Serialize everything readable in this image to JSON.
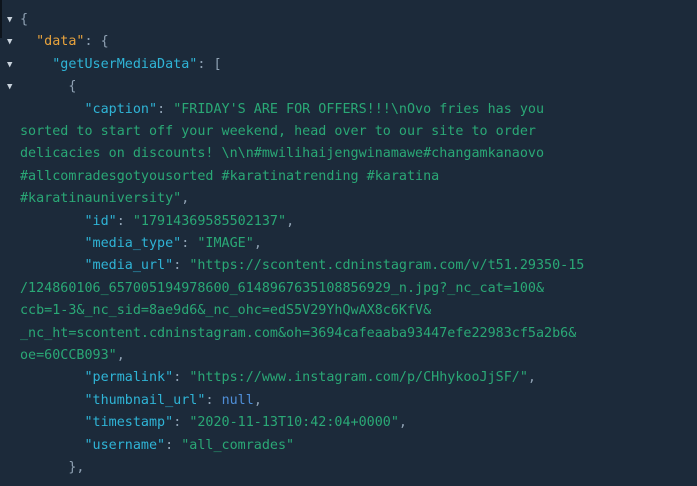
{
  "json_viewer": {
    "arrow_glyph": "▼",
    "lines": [
      {
        "has_arrow": true,
        "indent": "",
        "parts": [
          {
            "t": "{",
            "c": "p"
          }
        ]
      },
      {
        "has_arrow": true,
        "indent": "  ",
        "parts": [
          {
            "t": "\"data\"",
            "c": "k-orange"
          },
          {
            "t": ": {",
            "c": "p"
          }
        ]
      },
      {
        "has_arrow": true,
        "indent": "    ",
        "parts": [
          {
            "t": "\"getUserMediaData\"",
            "c": "k-teal"
          },
          {
            "t": ": [",
            "c": "p"
          }
        ]
      },
      {
        "has_arrow": true,
        "indent": "      ",
        "parts": [
          {
            "t": "{",
            "c": "p"
          }
        ]
      },
      {
        "has_arrow": false,
        "indent": "        ",
        "parts": [
          {
            "t": "\"caption\"",
            "c": "k-teal"
          },
          {
            "t": ": ",
            "c": "p"
          },
          {
            "t": "\"FRIDAY'S ARE FOR OFFERS!!!\\nOvo fries has you",
            "c": "s"
          }
        ]
      },
      {
        "has_arrow": false,
        "indent": "",
        "parts": [
          {
            "t": "sorted to start off your weekend, head over to our site to order",
            "c": "s"
          }
        ]
      },
      {
        "has_arrow": false,
        "indent": "",
        "parts": [
          {
            "t": "delicacies on discounts! \\n\\n#mwilihaijengwinamawe#changamkanaovo",
            "c": "s"
          }
        ]
      },
      {
        "has_arrow": false,
        "indent": "",
        "parts": [
          {
            "t": "#allcomradesgotyousorted #karatinatrending #karatina",
            "c": "s"
          }
        ]
      },
      {
        "has_arrow": false,
        "indent": "",
        "parts": [
          {
            "t": "#karatinauniversity\"",
            "c": "s"
          },
          {
            "t": ",",
            "c": "p"
          }
        ]
      },
      {
        "has_arrow": false,
        "indent": "        ",
        "parts": [
          {
            "t": "\"id\"",
            "c": "k-teal"
          },
          {
            "t": ": ",
            "c": "p"
          },
          {
            "t": "\"17914369585502137\"",
            "c": "s"
          },
          {
            "t": ",",
            "c": "p"
          }
        ]
      },
      {
        "has_arrow": false,
        "indent": "        ",
        "parts": [
          {
            "t": "\"media_type\"",
            "c": "k-teal"
          },
          {
            "t": ": ",
            "c": "p"
          },
          {
            "t": "\"IMAGE\"",
            "c": "s"
          },
          {
            "t": ",",
            "c": "p"
          }
        ]
      },
      {
        "has_arrow": false,
        "indent": "        ",
        "parts": [
          {
            "t": "\"media_url\"",
            "c": "k-teal"
          },
          {
            "t": ": ",
            "c": "p"
          },
          {
            "t": "\"https://scontent.cdninstagram.com/v/t51.29350-15",
            "c": "s"
          }
        ]
      },
      {
        "has_arrow": false,
        "indent": "",
        "parts": [
          {
            "t": "/124860106_657005194978600_6148967635108856929_n.jpg?_nc_cat=100&",
            "c": "s"
          }
        ]
      },
      {
        "has_arrow": false,
        "indent": "",
        "parts": [
          {
            "t": "ccb=1-3&_nc_sid=8ae9d6&_nc_ohc=edS5V29YhQwAX8c6KfV&",
            "c": "s"
          }
        ]
      },
      {
        "has_arrow": false,
        "indent": "",
        "parts": [
          {
            "t": "_nc_ht=scontent.cdninstagram.com&oh=3694cafeaaba93447efe22983cf5a2b6&",
            "c": "s"
          }
        ]
      },
      {
        "has_arrow": false,
        "indent": "",
        "parts": [
          {
            "t": "oe=60CCB093\"",
            "c": "s"
          },
          {
            "t": ",",
            "c": "p"
          }
        ]
      },
      {
        "has_arrow": false,
        "indent": "        ",
        "parts": [
          {
            "t": "\"permalink\"",
            "c": "k-teal"
          },
          {
            "t": ": ",
            "c": "p"
          },
          {
            "t": "\"https://www.instagram.com/p/CHhykooJjSF/\"",
            "c": "s"
          },
          {
            "t": ",",
            "c": "p"
          }
        ]
      },
      {
        "has_arrow": false,
        "indent": "        ",
        "parts": [
          {
            "t": "\"thumbnail_url\"",
            "c": "k-teal"
          },
          {
            "t": ": ",
            "c": "p"
          },
          {
            "t": "null",
            "c": "n"
          },
          {
            "t": ",",
            "c": "p"
          }
        ]
      },
      {
        "has_arrow": false,
        "indent": "        ",
        "parts": [
          {
            "t": "\"timestamp\"",
            "c": "k-teal"
          },
          {
            "t": ": ",
            "c": "p"
          },
          {
            "t": "\"2020-11-13T10:42:04+0000\"",
            "c": "s"
          },
          {
            "t": ",",
            "c": "p"
          }
        ]
      },
      {
        "has_arrow": false,
        "indent": "        ",
        "parts": [
          {
            "t": "\"username\"",
            "c": "k-teal"
          },
          {
            "t": ": ",
            "c": "p"
          },
          {
            "t": "\"all_comrades\"",
            "c": "s"
          }
        ]
      },
      {
        "has_arrow": false,
        "indent": "      ",
        "parts": [
          {
            "t": "},",
            "c": "p"
          }
        ]
      }
    ]
  },
  "colors": {
    "background": "#1c2a3a",
    "punctuation": "#8fa1b3",
    "root_key": "#e8a33d",
    "key": "#2fb4d6",
    "string": "#2aa876",
    "null": "#4f8fd8"
  }
}
